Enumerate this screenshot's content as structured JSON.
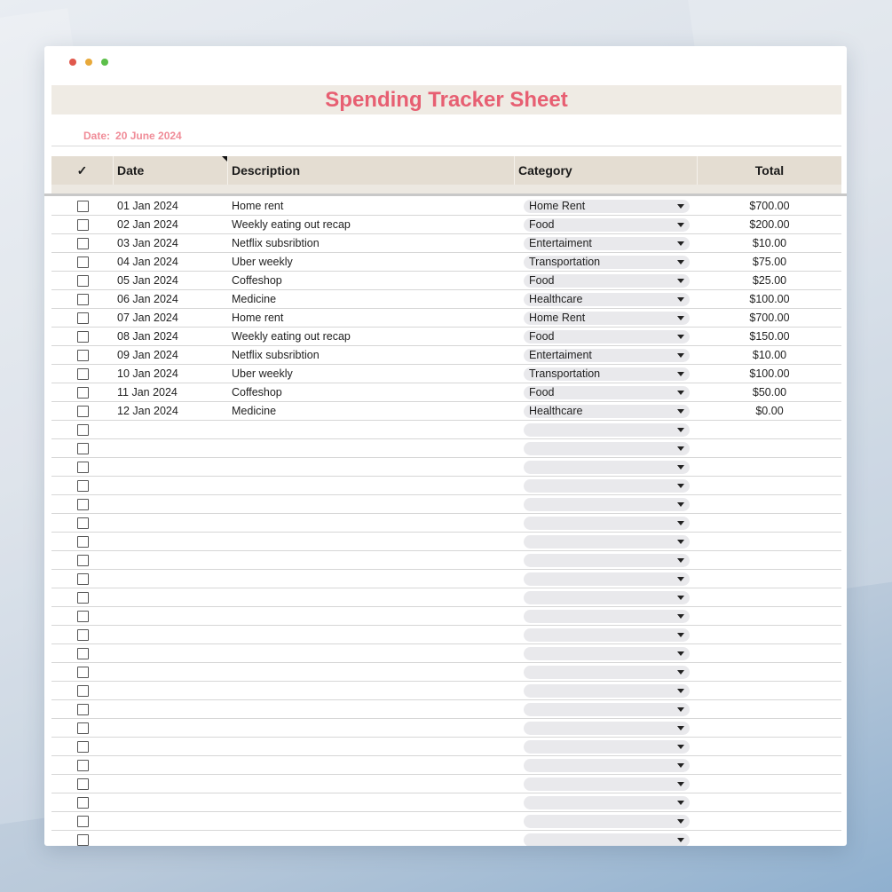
{
  "window": {
    "dots": [
      {
        "color": "#e0584c"
      },
      {
        "color": "#e8a93a"
      },
      {
        "color": "#5cbf4a"
      }
    ]
  },
  "sheet": {
    "title": "Spending Tracker Sheet",
    "date_label": "Date:",
    "date_value": "20 June 2024",
    "accent_color": "#e75f72"
  },
  "table": {
    "headers": {
      "check": "✓",
      "date": "Date",
      "description": "Description",
      "category": "Category",
      "total": "Total"
    },
    "rows": [
      {
        "date": "01 Jan 2024",
        "description": "Home rent",
        "category": "Home Rent",
        "total": "$700.00"
      },
      {
        "date": "02 Jan 2024",
        "description": "Weekly eating out recap",
        "category": "Food",
        "total": "$200.00"
      },
      {
        "date": "03 Jan 2024",
        "description": "Netflix subsribtion",
        "category": "Entertaiment",
        "total": "$10.00"
      },
      {
        "date": "04 Jan 2024",
        "description": "Uber weekly",
        "category": "Transportation",
        "total": "$75.00"
      },
      {
        "date": "05 Jan 2024",
        "description": "Coffeshop",
        "category": "Food",
        "total": "$25.00"
      },
      {
        "date": "06 Jan 2024",
        "description": "Medicine",
        "category": "Healthcare",
        "total": "$100.00"
      },
      {
        "date": "07 Jan 2024",
        "description": "Home rent",
        "category": "Home Rent",
        "total": "$700.00"
      },
      {
        "date": "08 Jan 2024",
        "description": "Weekly eating out recap",
        "category": "Food",
        "total": "$150.00"
      },
      {
        "date": "09 Jan 2024",
        "description": "Netflix subsribtion",
        "category": "Entertaiment",
        "total": "$10.00"
      },
      {
        "date": "10 Jan 2024",
        "description": "Uber weekly",
        "category": "Transportation",
        "total": "$100.00"
      },
      {
        "date": "11 Jan 2024",
        "description": "Coffeshop",
        "category": "Food",
        "total": "$50.00"
      },
      {
        "date": "12 Jan 2024",
        "description": "Medicine",
        "category": "Healthcare",
        "total": "$0.00"
      },
      {
        "date": "",
        "description": "",
        "category": "",
        "total": ""
      },
      {
        "date": "",
        "description": "",
        "category": "",
        "total": ""
      },
      {
        "date": "",
        "description": "",
        "category": "",
        "total": ""
      },
      {
        "date": "",
        "description": "",
        "category": "",
        "total": ""
      },
      {
        "date": "",
        "description": "",
        "category": "",
        "total": ""
      },
      {
        "date": "",
        "description": "",
        "category": "",
        "total": ""
      },
      {
        "date": "",
        "description": "",
        "category": "",
        "total": ""
      },
      {
        "date": "",
        "description": "",
        "category": "",
        "total": ""
      },
      {
        "date": "",
        "description": "",
        "category": "",
        "total": ""
      },
      {
        "date": "",
        "description": "",
        "category": "",
        "total": ""
      },
      {
        "date": "",
        "description": "",
        "category": "",
        "total": ""
      },
      {
        "date": "",
        "description": "",
        "category": "",
        "total": ""
      },
      {
        "date": "",
        "description": "",
        "category": "",
        "total": ""
      },
      {
        "date": "",
        "description": "",
        "category": "",
        "total": ""
      },
      {
        "date": "",
        "description": "",
        "category": "",
        "total": ""
      },
      {
        "date": "",
        "description": "",
        "category": "",
        "total": ""
      },
      {
        "date": "",
        "description": "",
        "category": "",
        "total": ""
      },
      {
        "date": "",
        "description": "",
        "category": "",
        "total": ""
      },
      {
        "date": "",
        "description": "",
        "category": "",
        "total": ""
      },
      {
        "date": "",
        "description": "",
        "category": "",
        "total": ""
      },
      {
        "date": "",
        "description": "",
        "category": "",
        "total": ""
      },
      {
        "date": "",
        "description": "",
        "category": "",
        "total": ""
      },
      {
        "date": "",
        "description": "",
        "category": "",
        "total": ""
      },
      {
        "date": "",
        "description": "",
        "category": "",
        "total": ""
      },
      {
        "date": "",
        "description": "",
        "category": "",
        "total": ""
      },
      {
        "date": "",
        "description": "",
        "category": "",
        "total": ""
      }
    ]
  }
}
